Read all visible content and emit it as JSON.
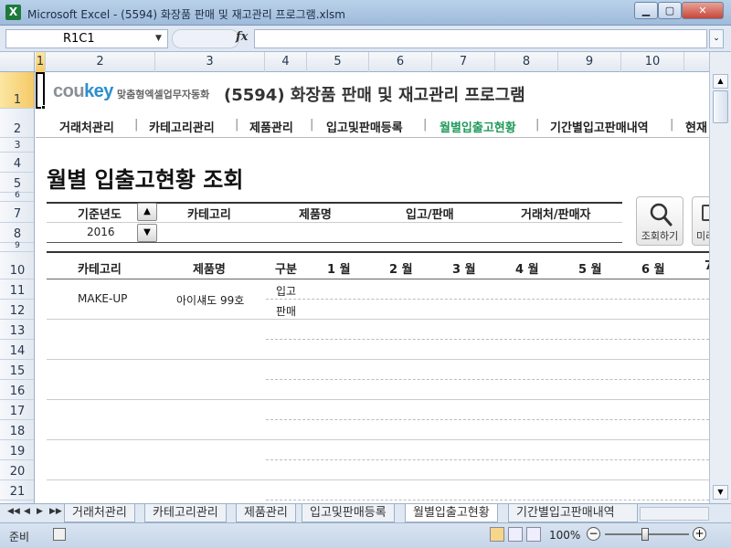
{
  "window": {
    "title": "Microsoft Excel - (5594) 화장품 판매 및 재고관리 프로그램.xlsm",
    "icon_letter": "X",
    "min_glyph": "▁",
    "max_glyph": "▢",
    "close_glyph": "✕"
  },
  "formula_bar": {
    "name_box": "R1C1",
    "fx": "fx",
    "value": "",
    "dropdown_glyph": "▼"
  },
  "columns": [
    "1",
    "2",
    "3",
    "4",
    "5",
    "6",
    "7",
    "8",
    "9",
    "10"
  ],
  "rows": [
    "1",
    "2",
    "3",
    "4",
    "5",
    "6",
    "7",
    "8",
    "9",
    "10",
    "11",
    "12",
    "13",
    "14",
    "15",
    "16",
    "17",
    "18",
    "19",
    "20",
    "21"
  ],
  "logo": {
    "co": "cou",
    "key": "key",
    "tagline": "맞춤형엑셀업무자동화"
  },
  "doc_title": "(5594) 화장품 판매 및 재고관리 프로그램",
  "nav": {
    "items": [
      "거래처관리",
      "카테고리관리",
      "제품관리",
      "입고및판매등록",
      "월별입출고현황",
      "기간별입고판매내역",
      "현재"
    ],
    "separator": "|",
    "active": "월별입출고현황"
  },
  "page_title": "월별 입출고현황 조회",
  "filters": {
    "labels": [
      "기준년도",
      "카테고리",
      "제품명",
      "입고/판매",
      "거래처/판매자"
    ],
    "year": "2016",
    "up_glyph": "▲",
    "down_glyph": "▼"
  },
  "buttons": {
    "search": "조회하기",
    "next": "미리"
  },
  "table": {
    "headers": [
      "카테고리",
      "제품명",
      "구분",
      "1 월",
      "2 월",
      "3 월",
      "4 월",
      "5 월",
      "6 월",
      "7"
    ],
    "rows": [
      {
        "category": "MAKE-UP",
        "product": "아이섀도 99호",
        "types": [
          "입고",
          "판매"
        ]
      }
    ]
  },
  "sheet_tabs": {
    "items": [
      "거래처관리",
      "카테고리관리",
      "제품관리",
      "입고및판매등록",
      "월별입출고현황",
      "기간별입고판매내역"
    ],
    "active": "월별입출고현황",
    "nav_glyphs": [
      "◀◀",
      "◀",
      "▶",
      "▶▶"
    ]
  },
  "status": {
    "ready": "준비",
    "zoom": "100%",
    "minus": "−",
    "plus": "+"
  },
  "colors": {
    "accent_active_nav": "#1f9a5a",
    "logo_key": "#2a8fd0",
    "selected_header": "#f5c965"
  }
}
